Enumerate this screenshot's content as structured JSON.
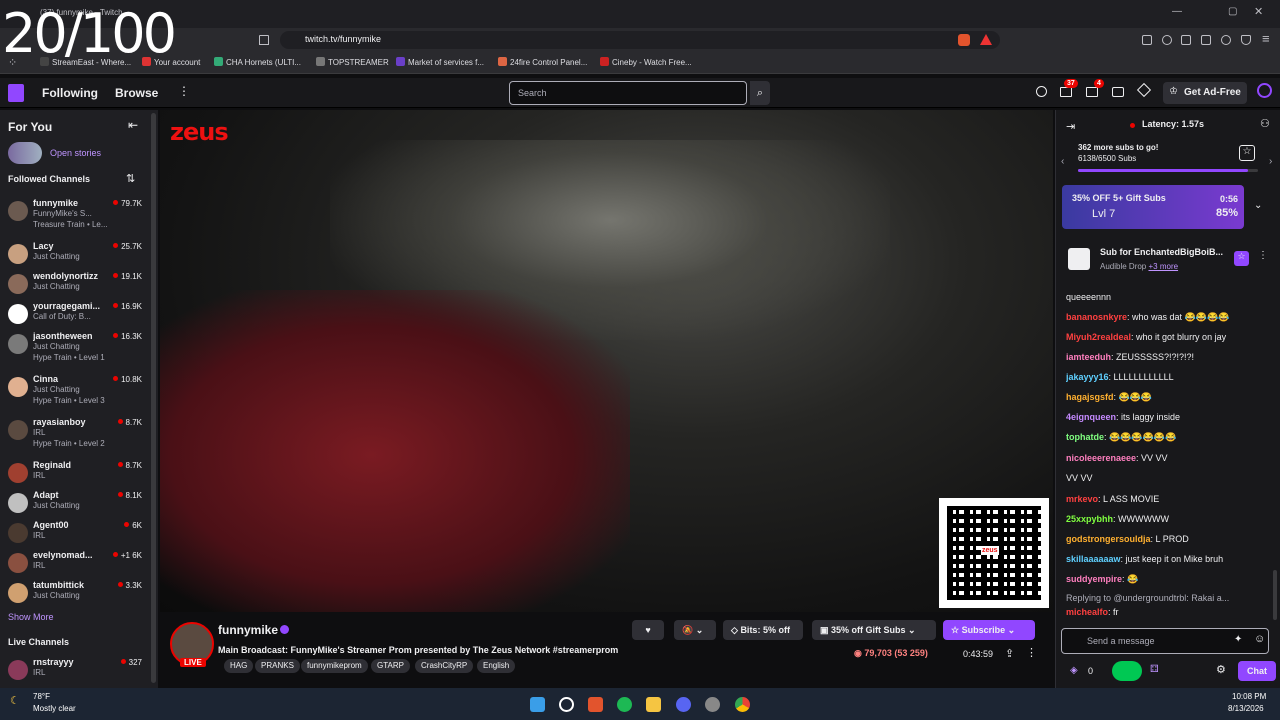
{
  "overlay_counter": "20/100",
  "browser": {
    "tab_title": "(37) funnymike - Twitch",
    "url": "twitch.tv/funnymike",
    "bookmarks": [
      {
        "label": "StreamEast - Where...",
        "color": "#444"
      },
      {
        "label": "Your account",
        "color": "#d33"
      },
      {
        "label": "CHA Hornets (ULTI...",
        "color": "#3a7"
      },
      {
        "label": "TOPSTREAMER",
        "color": "#777"
      },
      {
        "label": "Market of services f...",
        "color": "#6a3fc8"
      },
      {
        "label": "24fire Control Panel...",
        "color": "#d64"
      },
      {
        "label": "Cineby - Watch Free...",
        "color": "#c22"
      }
    ]
  },
  "nav": {
    "following": "Following",
    "browse": "Browse",
    "search_placeholder": "Search",
    "notif_count": "37",
    "inbox_count": "4",
    "get_ad_free": "Get Ad-Free"
  },
  "sidebar": {
    "for_you": "For You",
    "open_stories": "Open stories",
    "followed_channels": "Followed Channels",
    "show_more": "Show More",
    "live_channels": "Live Channels",
    "channels": [
      {
        "name": "funnymike",
        "category": "FunnyMike's S...",
        "extra": "Treasure Train • Le...",
        "viewers": "79.7K",
        "color": "#6b5a50"
      },
      {
        "name": "Lacy",
        "category": "Just Chatting",
        "extra": "",
        "viewers": "25.7K",
        "color": "#c8a080"
      },
      {
        "name": "wendolynortizz",
        "category": "Just Chatting",
        "extra": "",
        "viewers": "19.1K",
        "color": "#8a6a5a"
      },
      {
        "name": "yourragegami...",
        "category": "Call of Duty: B...",
        "extra": "",
        "viewers": "16.9K",
        "color": "#ffffff"
      },
      {
        "name": "jasontheween",
        "category": "Just Chatting",
        "extra": "Hype Train • Level 1",
        "viewers": "16.3K",
        "color": "#7a7a7a"
      },
      {
        "name": "Cinna",
        "category": "Just Chatting",
        "extra": "Hype Train • Level 3",
        "viewers": "10.8K",
        "color": "#e0b090"
      },
      {
        "name": "rayasianboy",
        "category": "IRL",
        "extra": "Hype Train • Level 2",
        "viewers": "8.7K",
        "color": "#5a4a40"
      },
      {
        "name": "Reginald",
        "category": "IRL",
        "extra": "",
        "viewers": "8.7K",
        "color": "#a04030"
      },
      {
        "name": "Adapt",
        "category": "Just Chatting",
        "extra": "",
        "viewers": "8.1K",
        "color": "#c0c0c0"
      },
      {
        "name": "Agent00",
        "category": "IRL",
        "extra": "",
        "viewers": "6K",
        "color": "#4a3a30"
      },
      {
        "name": "evelynomad...",
        "category": "IRL",
        "extra": "",
        "viewers": "+1  6K",
        "color": "#8a5040"
      },
      {
        "name": "tatumbittick",
        "category": "Just Chatting",
        "extra": "",
        "viewers": "3.3K",
        "color": "#d0a070"
      }
    ],
    "live": {
      "name": "rnstrayyy",
      "category": "IRL",
      "viewers": "327",
      "color": "#8a3a5a"
    }
  },
  "stream": {
    "streamer": "funnymike",
    "live": "LIVE",
    "title": "Main Broadcast: FunnyMike's Streamer Prom presented by The Zeus Network #streamerprom",
    "tags": [
      "HAG",
      "PRANKS",
      "funnymikeprom",
      "GTARP",
      "CrashCityRP",
      "English"
    ],
    "bits": "Bits: 5% off",
    "gift_subs": "35% off Gift Subs",
    "subscribe": "Subscribe",
    "viewers": "79,703 (53 259)",
    "uptime": "0:43:59",
    "brand": "zeus"
  },
  "chat": {
    "latency": "Latency: 1.57s",
    "subs_goal": "362 more subs to go!",
    "subs_count": "6138/6500 Subs",
    "promo": {
      "title": "35% OFF 5+ Gift Subs",
      "timer": "0:56",
      "level": "Lvl 7",
      "pct": "85%"
    },
    "sub_for": "Sub for EnchantedBigBoiB...",
    "drop": "Audible Drop",
    "more": "+3 more",
    "messages": [
      {
        "user": "",
        "color": "#efeff1",
        "text": "queeeennn"
      },
      {
        "user": "bananosnkyre",
        "color": "#ff4040",
        "text": ": who was dat 😂😂😂😂"
      },
      {
        "user": "Miyuh2realdeal",
        "color": "#ff4040",
        "text": ": who it got blurry on jay"
      },
      {
        "user": "iamteeduh",
        "color": "#ff7fbf",
        "text": ": ZEUSSSSS?!?!?!?!"
      },
      {
        "user": "jakayyy16",
        "color": "#5fd0ff",
        "text": ": LLLLLLLLLLLL"
      },
      {
        "user": "hagajsgsfd",
        "color": "#ffb030",
        "text": ": 😂😂😂"
      },
      {
        "user": "4eignqueen",
        "color": "#c58aff",
        "text": ": its laggy inside"
      },
      {
        "user": "tophatde",
        "color": "#80ff80",
        "text": ": 😂😂😂😂😂😂"
      },
      {
        "user": "nicoleeerenaeee",
        "color": "#ff7fbf",
        "text": ": VV VV"
      },
      {
        "user": "",
        "color": "#efeff1",
        "text": "VV  VV"
      },
      {
        "user": "mrkevo",
        "color": "#ff4040",
        "text": ": L ASS MOVIE"
      },
      {
        "user": "25xxpybhh",
        "color": "#80ff40",
        "text": ": WWWWWW"
      },
      {
        "user": "godstrongersouldja",
        "color": "#ffb030",
        "text": ": L PROD"
      },
      {
        "user": "skillaaaaaaw",
        "color": "#5fd0ff",
        "text": ": just keep it on Mike bruh"
      },
      {
        "user": "suddyempire",
        "color": "#ff7fbf",
        "text": ": 😂"
      },
      {
        "user": "",
        "color": "#adadb8",
        "text": "Replying to @undergroundtrbl: Rakai a..."
      },
      {
        "user": "michealfo",
        "color": "#ff4040",
        "text": ": fr"
      }
    ],
    "send_placeholder": "Send a message",
    "points": "0",
    "chat_button": "Chat"
  },
  "taskbar": {
    "weather_temp": "78°F",
    "weather_text": "Mostly clear",
    "time": "10:08 PM",
    "date": "8/13/2026"
  }
}
